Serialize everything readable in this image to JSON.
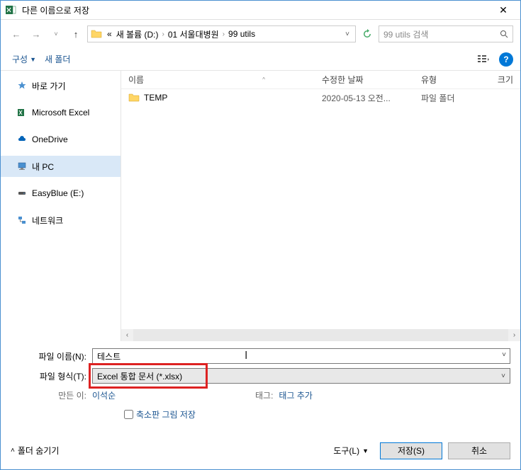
{
  "title": "다른 이름으로 저장",
  "breadcrumb": {
    "prefix": "«",
    "parts": [
      "새 볼륨 (D:)",
      "01 서울대병원",
      "99 utils"
    ]
  },
  "search": {
    "placeholder": "99 utils 검색"
  },
  "toolbar": {
    "organize": "구성",
    "newfolder": "새 폴더"
  },
  "sidebar": [
    {
      "id": "quick",
      "label": "바로 가기",
      "icon": "star"
    },
    {
      "id": "excel",
      "label": "Microsoft Excel",
      "icon": "excel"
    },
    {
      "id": "onedrive",
      "label": "OneDrive",
      "icon": "cloud"
    },
    {
      "id": "pc",
      "label": "내 PC",
      "icon": "pc",
      "selected": true
    },
    {
      "id": "easyblue",
      "label": "EasyBlue (E:)",
      "icon": "drive"
    },
    {
      "id": "network",
      "label": "네트워크",
      "icon": "network"
    }
  ],
  "columns": {
    "name": "이름",
    "date": "수정한 날짜",
    "type": "유형",
    "size": "크기"
  },
  "files": [
    {
      "name": "TEMP",
      "date": "2020-05-13 오전...",
      "type": "파일 폴더",
      "icon": "folder"
    }
  ],
  "form": {
    "filename_label": "파일 이름(N):",
    "filename_value": "테스트",
    "filetype_label": "파일 형식(T):",
    "filetype_value": "Excel 통합 문서 (*.xlsx)",
    "author_label": "만든 이:",
    "author_value": "이석순",
    "tag_label": "태그:",
    "tag_value": "태그 추가",
    "thumbnail_label": "축소판 그림 저장"
  },
  "buttons": {
    "hide_folders": "폴더 숨기기",
    "tools": "도구(L)",
    "save": "저장(S)",
    "cancel": "취소"
  }
}
